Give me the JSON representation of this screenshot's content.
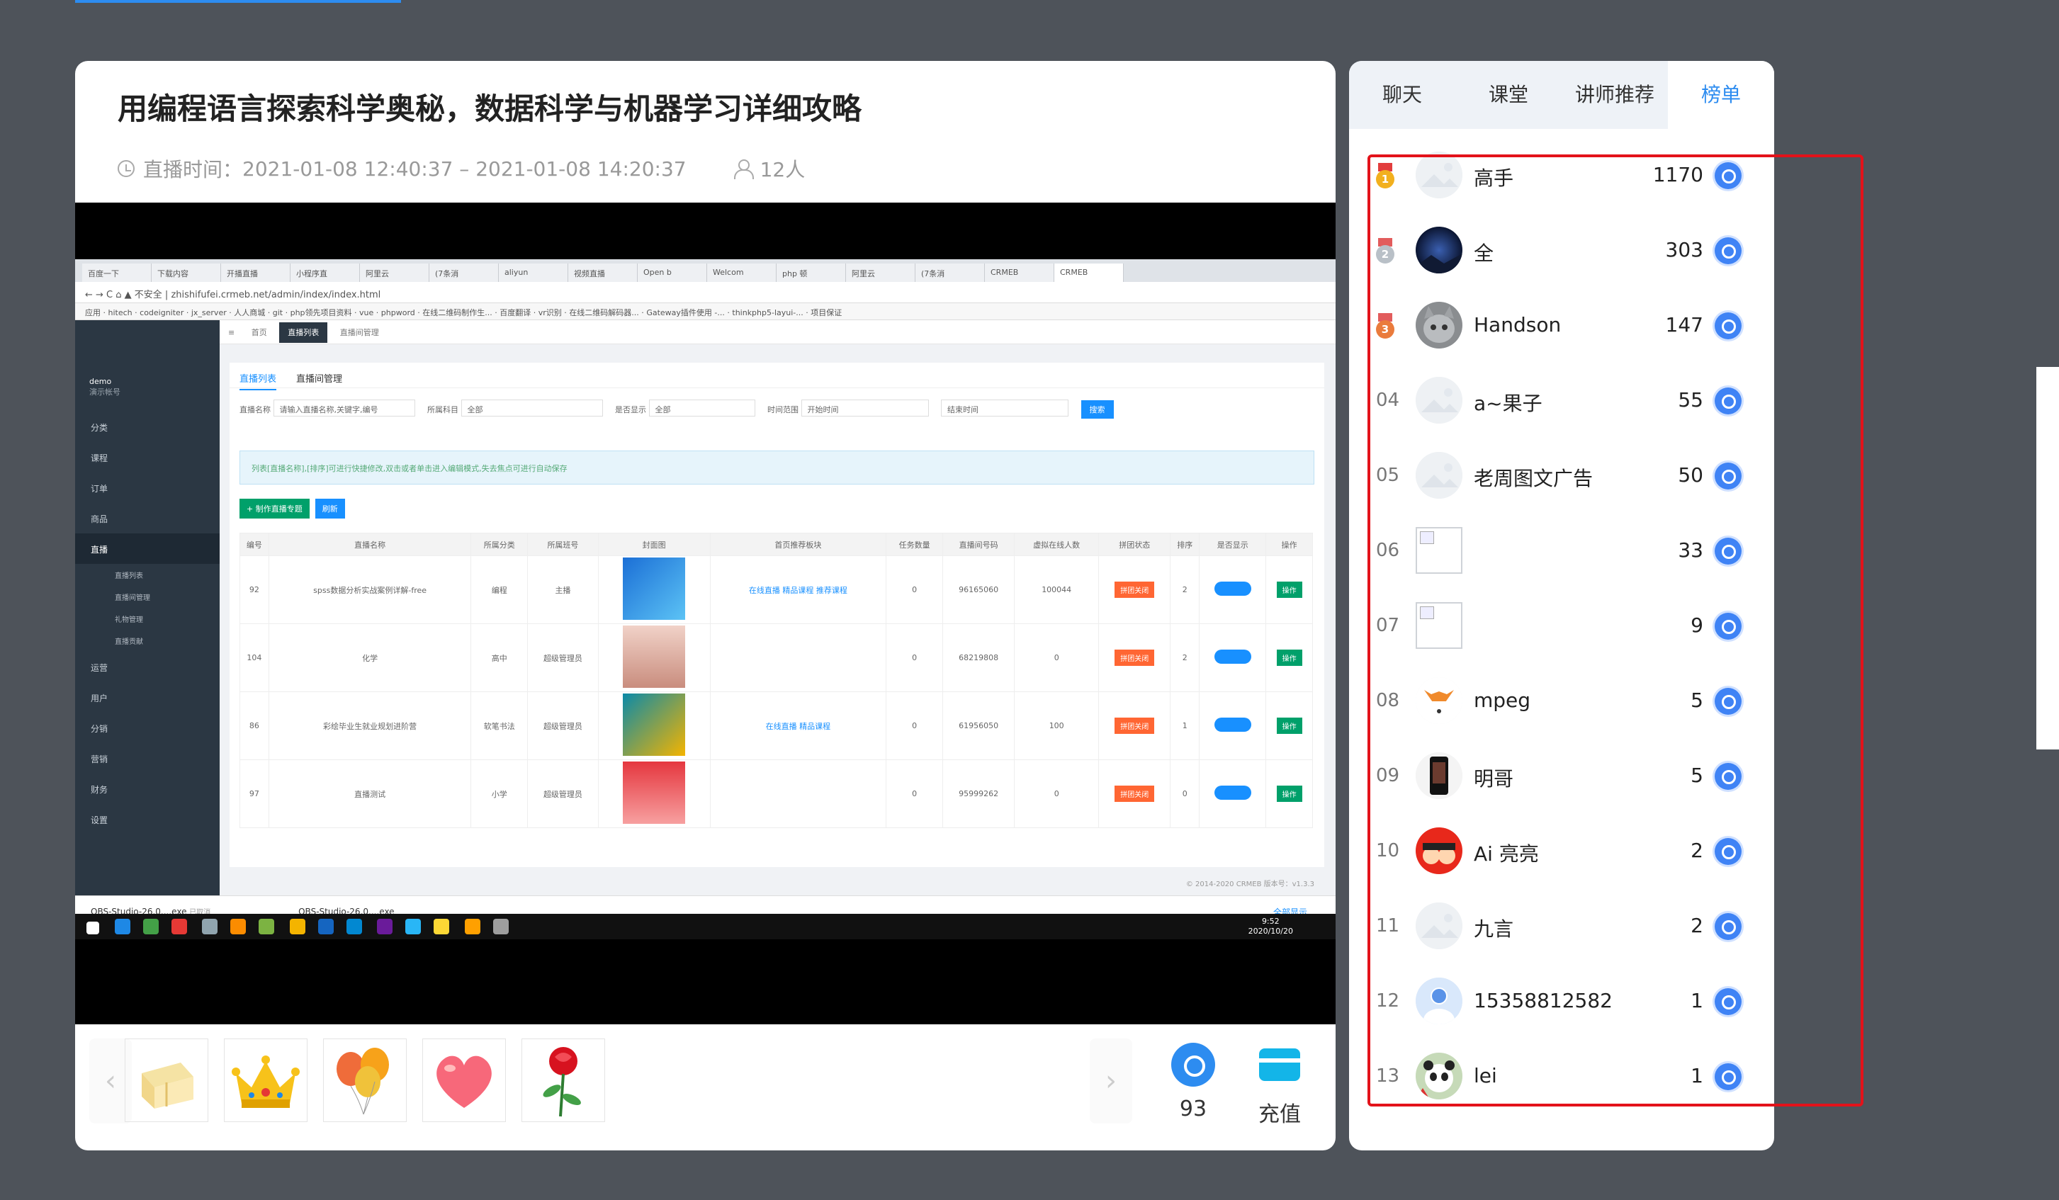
{
  "course": {
    "title": "用编程语言探索科学奥秘，数据科学与机器学习详细攻略",
    "time_label": "直播时间：",
    "time_range": "2021-01-08 12:40:37 – 2021-01-08 14:20:37",
    "viewers": "12人"
  },
  "screenshot": {
    "browser_tabs": [
      "百度一下",
      "下载内容",
      "开播直播",
      "小程序直",
      "阿里云",
      "(7条消",
      "aliyun",
      "视频直播",
      "Open b",
      "Welcom",
      "php 顿",
      "阿里云",
      "(7条消",
      "CRMEB",
      "CRMEB"
    ],
    "url_secure": "不安全",
    "url": "zhishifufei.crmeb.net/admin/index/index.html",
    "bookmarks": [
      "应用",
      "hitech",
      "codeigniter",
      "jx_server",
      "人人商城",
      "git",
      "php领先项目资料",
      "vue",
      "phpword",
      "在线二维码制作生...",
      "百度翻译",
      "vr识别",
      "在线二维码解码器...",
      "Gateway插件使用 -...",
      "thinkphp5-layui-...",
      "项目保证"
    ],
    "sidebar_user": "demo",
    "sidebar_role": "演示帐号",
    "sidebar_items": [
      "分类",
      "课程",
      "订单",
      "商品",
      "直播",
      "运营",
      "用户",
      "分销",
      "营销",
      "财务",
      "设置"
    ],
    "sidebar_sub": [
      "直播列表",
      "直播间管理",
      "礼物管理",
      "直播贡献"
    ],
    "top_tabs": [
      "首页",
      "直播列表",
      "直播间管理"
    ],
    "panel_tabs": [
      "直播列表",
      "直播间管理"
    ],
    "filters": {
      "name_label": "直播名称",
      "name_placeholder": "请输入直播名称,关键字,编号",
      "subject_label": "所属科目",
      "subject_value": "全部",
      "show_label": "是否显示",
      "show_value": "全部",
      "time_label": "时间范围",
      "start_placeholder": "开始时间",
      "end_placeholder": "结束时间",
      "search": "搜索"
    },
    "notice": "列表[直播名称],[排序]可进行快捷修改,双击或者单击进入编辑模式,失去焦点可进行自动保存",
    "btn_add": "+ 制作直播专题",
    "btn_refresh": "刷新",
    "headers": [
      "编号",
      "直播名称",
      "所属分类",
      "所属班号",
      "封面图",
      "首页推荐板块",
      "任务数量",
      "直播间号码",
      "虚拟在线人数",
      "拼团状态",
      "排序",
      "是否显示",
      "操作"
    ],
    "rows": [
      {
        "id": "92",
        "name": "spss数据分析实战案例详解-free",
        "cat": "编程",
        "grade": "主播",
        "tags": "在线直播 精品课程 推荐课程",
        "tasks": "0",
        "room": "96165060",
        "virtual": "100044",
        "group": "拼团关闭",
        "sort": "2",
        "show": "显示",
        "op": "操作"
      },
      {
        "id": "104",
        "name": "化学",
        "cat": "高中",
        "grade": "超级管理员",
        "tags": "",
        "tasks": "0",
        "room": "68219808",
        "virtual": "0",
        "group": "拼团关闭",
        "sort": "2",
        "show": "显示",
        "op": "操作"
      },
      {
        "id": "86",
        "name": "彩绘毕业生就业规划进阶营",
        "cat": "软笔书法",
        "grade": "超级管理员",
        "tags": "在线直播 精品课程",
        "tasks": "0",
        "room": "61956050",
        "virtual": "100",
        "group": "拼团关闭",
        "sort": "1",
        "show": "显示",
        "op": "操作"
      },
      {
        "id": "97",
        "name": "直播测试",
        "cat": "小学",
        "grade": "超级管理员",
        "tags": "",
        "tasks": "0",
        "room": "95999262",
        "virtual": "0",
        "group": "拼团关闭",
        "sort": "0",
        "show": "显示",
        "op": "操作"
      }
    ],
    "footer": "© 2014-2020 CRMEB 版本号：v1.3.3",
    "downloads": [
      "OBS-Studio-26.0....exe",
      "OBS-Studio-26.0....exe"
    ],
    "download_sub": "已取消",
    "show_all": "全部显示",
    "clock_time": "9:52",
    "clock_date": "2020/10/20"
  },
  "gift_bar": {
    "coin_count": "93",
    "recharge": "充值"
  },
  "side_tabs": [
    "聊天",
    "课堂",
    "讲师推荐",
    "榜单"
  ],
  "leaderboard": [
    {
      "rank": "1",
      "name": "高手",
      "value": "1170",
      "medal": "gold",
      "avatar": "placeholder"
    },
    {
      "rank": "2",
      "name": "全",
      "value": "303",
      "medal": "silver",
      "avatar": "night"
    },
    {
      "rank": "3",
      "name": "Handson",
      "value": "147",
      "medal": "bronze",
      "avatar": "cat"
    },
    {
      "rank": "04",
      "name": "a~果子",
      "value": "55",
      "avatar": "placeholder"
    },
    {
      "rank": "05",
      "name": "老周图文广告",
      "value": "50",
      "avatar": "placeholder"
    },
    {
      "rank": "06",
      "name": "",
      "value": "33",
      "avatar": "broken"
    },
    {
      "rank": "07",
      "name": "",
      "value": "9",
      "avatar": "broken"
    },
    {
      "rank": "08",
      "name": "mpeg",
      "value": "5",
      "avatar": "fox"
    },
    {
      "rank": "09",
      "name": "明哥",
      "value": "5",
      "avatar": "phone"
    },
    {
      "rank": "10",
      "name": "Ai 亮亮",
      "value": "2",
      "avatar": "red"
    },
    {
      "rank": "11",
      "name": "九言",
      "value": "2",
      "avatar": "placeholder"
    },
    {
      "rank": "12",
      "name": "15358812582",
      "value": "1",
      "avatar": "default"
    },
    {
      "rank": "13",
      "name": "lei",
      "value": "1",
      "avatar": "panda"
    }
  ],
  "colors": {
    "accent": "#2d8cf0",
    "highlight_box": "#e3121a",
    "background": "#4e535a"
  }
}
